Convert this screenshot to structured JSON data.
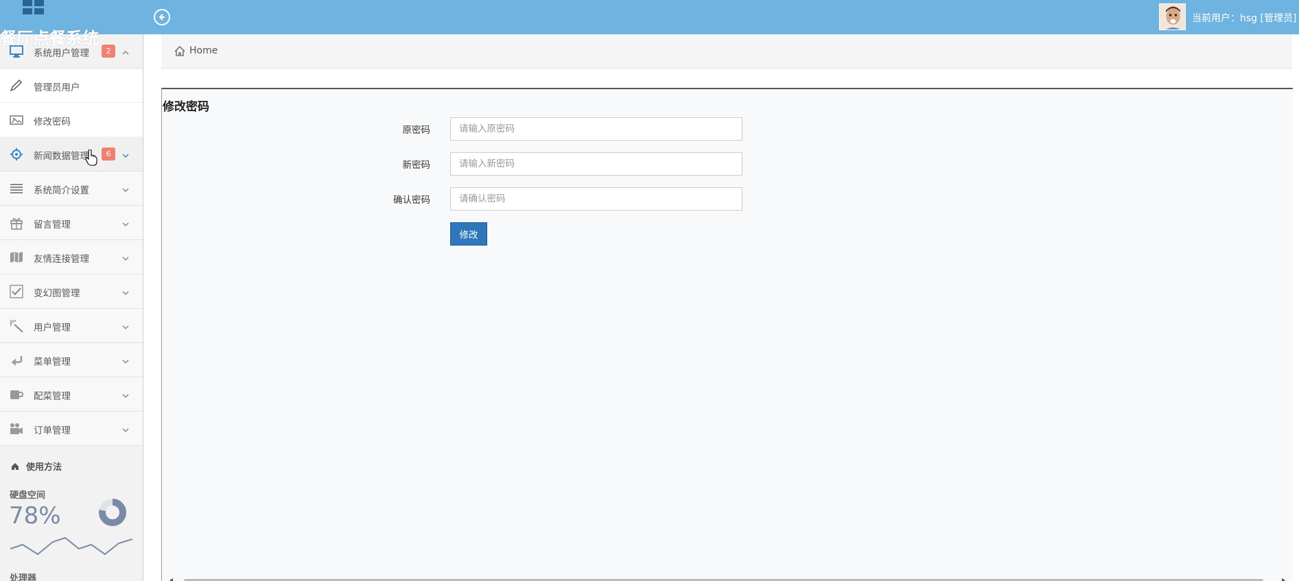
{
  "app": {
    "title": "餐厅点餐系统",
    "user_label": "当前用户：hsg [管理员]"
  },
  "sidebar": {
    "groups": [
      {
        "label": "系统用户管理",
        "badge": "2",
        "icon": "desktop-icon",
        "expanded": true,
        "children": [
          {
            "label": "管理员用户",
            "icon": "pencil-icon"
          },
          {
            "label": "修改密码",
            "icon": "picture-icon"
          }
        ]
      },
      {
        "label": "新闻数据管理",
        "badge": "6",
        "icon": "crosshair-icon"
      },
      {
        "label": "系统简介设置",
        "icon": "list-icon"
      },
      {
        "label": "留言管理",
        "icon": "gift-icon"
      },
      {
        "label": "友情连接管理",
        "icon": "map-icon"
      },
      {
        "label": "变幻图管理",
        "icon": "check-square-icon"
      },
      {
        "label": "用户管理",
        "icon": "magic-wand-icon"
      },
      {
        "label": "菜单管理",
        "icon": "reply-icon"
      },
      {
        "label": "配菜管理",
        "icon": "coffee-icon"
      },
      {
        "label": "订单管理",
        "icon": "camera-icon"
      }
    ],
    "usage": {
      "label": "使用方法"
    },
    "disk": {
      "title": "硬盘空间",
      "value": "78%",
      "fraction": 0.78
    },
    "cpu": {
      "title": "处理器"
    }
  },
  "breadcrumb": {
    "home": "Home"
  },
  "form": {
    "title": "修改密码",
    "fields": [
      {
        "label": "原密码",
        "placeholder": "请输入原密码",
        "value": ""
      },
      {
        "label": "新密码",
        "placeholder": "请输入新密码",
        "value": ""
      },
      {
        "label": "确认密码",
        "placeholder": "请确认密码",
        "value": ""
      }
    ],
    "submit_label": "修改"
  },
  "colors": {
    "topbar": "#6fb3e0",
    "badge": "#f08070",
    "primary_button": "#2f77bb",
    "donut": "#7b8aa6"
  }
}
